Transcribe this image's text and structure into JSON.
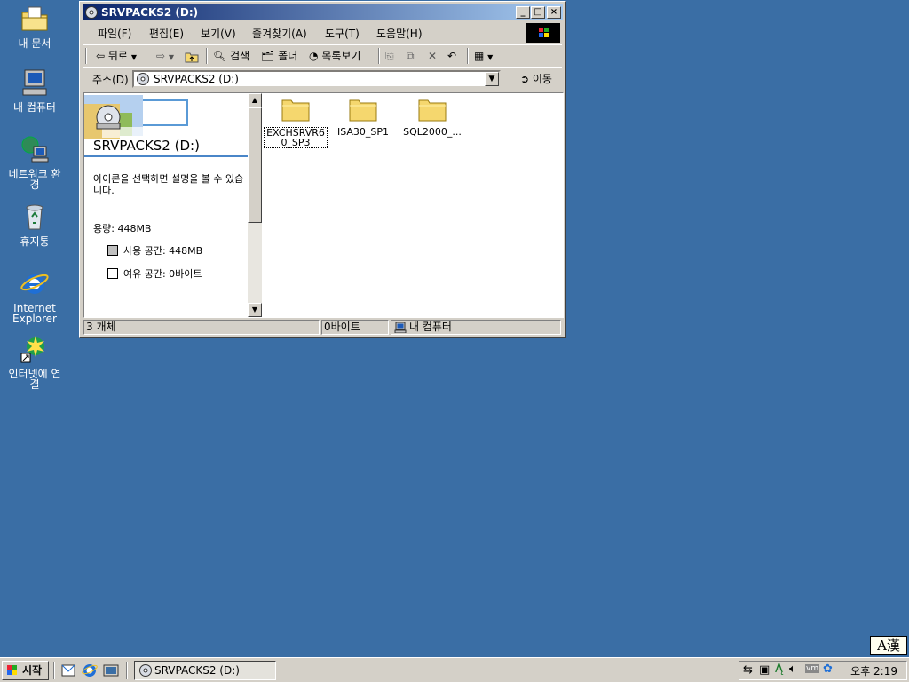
{
  "desktop": {
    "icons": [
      {
        "label": "내 문서",
        "icon": "my-documents-icon"
      },
      {
        "label": "내 컴퓨터",
        "icon": "my-computer-icon"
      },
      {
        "label": "네트워크 환경",
        "icon": "network-icon"
      },
      {
        "label": "휴지통",
        "icon": "recycle-bin-icon"
      },
      {
        "label": "Internet Explorer",
        "icon": "ie-icon"
      },
      {
        "label": "인터넷에 연결",
        "icon": "connect-internet-icon"
      }
    ]
  },
  "window": {
    "title": "SRVPACKS2 (D:)",
    "controls": {
      "minimize": "_",
      "maximize": "□",
      "close": "×"
    },
    "menu": [
      "파일(F)",
      "편집(E)",
      "보기(V)",
      "즐겨찾기(A)",
      "도구(T)",
      "도움말(H)"
    ],
    "toolbar": {
      "back": "뒤로",
      "search": "검색",
      "folders": "폴더",
      "history": "목록보기"
    },
    "address": {
      "label": "주소(D)",
      "value": "SRVPACKS2 (D:)",
      "go": "이동"
    },
    "leftpane": {
      "title": "SRVPACKS2 (D:)",
      "description": "아이콘을 선택하면 설명을 볼 수 있습니다.",
      "capacity": "용량: 448MB",
      "used": "사용 공간: 448MB",
      "free": "여유 공간: 0바이트",
      "used_color": "#c0c0c0",
      "free_color": "#ffffff"
    },
    "files": [
      {
        "name": "EXCHSRVR60_SP3",
        "line1": "EXCHSRVR6",
        "line2": "0_SP3",
        "selected": true
      },
      {
        "name": "ISA30_SP1",
        "line1": "ISA30_SP1",
        "line2": "",
        "selected": false
      },
      {
        "name": "SQL2000_...",
        "line1": "SQL2000_...",
        "line2": "",
        "selected": false
      }
    ],
    "status": {
      "count": "3 개체",
      "size": "0바이트",
      "zone": "내 컴퓨터"
    }
  },
  "taskbar": {
    "start": "시작",
    "task": "SRVPACKS2 (D:)",
    "clock": "오후 2:19",
    "ime": "A漢"
  },
  "colors": {
    "desktop": "#3a6ea5",
    "title_start": "#0a246a",
    "title_end": "#a6caf0",
    "face": "#d4d0c8",
    "folder": "#f5d76e"
  }
}
